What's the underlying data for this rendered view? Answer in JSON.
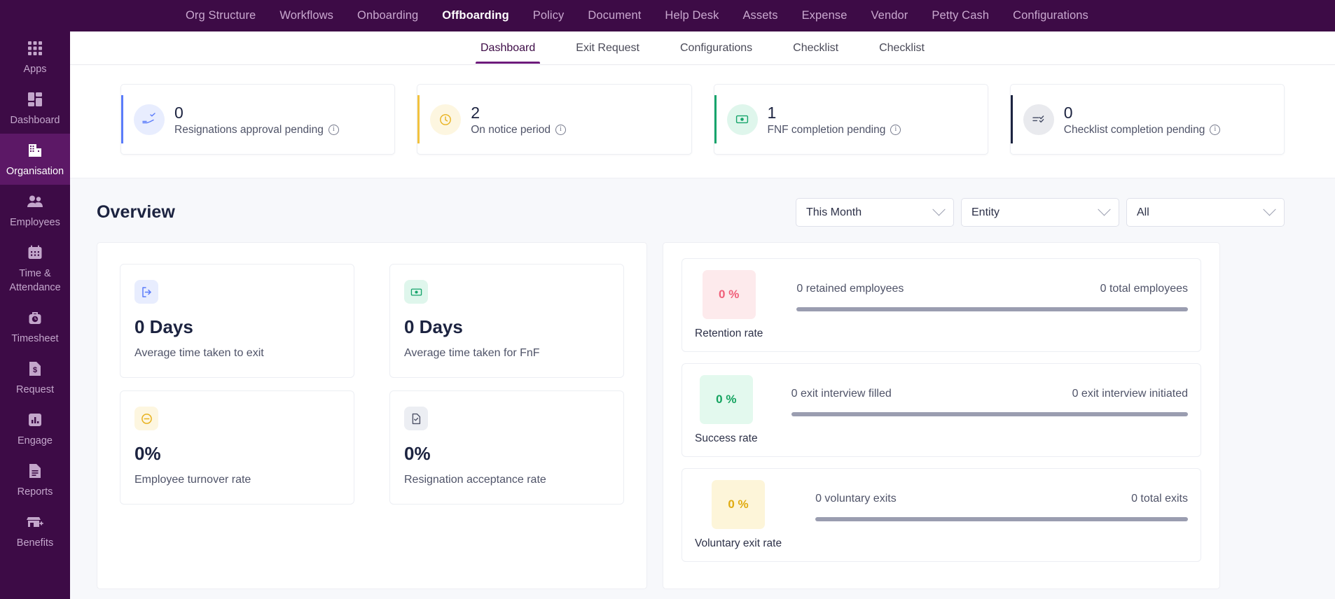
{
  "theme": {
    "brand_purple": "#3d0b46",
    "brand_purple_active": "#5c1866",
    "accent_underline": "#6d1b7b",
    "text_dark": "#1c2340"
  },
  "topnav": {
    "items": [
      {
        "label": "Org Structure",
        "active": false
      },
      {
        "label": "Workflows",
        "active": false
      },
      {
        "label": "Onboarding",
        "active": false
      },
      {
        "label": "Offboarding",
        "active": true
      },
      {
        "label": "Policy",
        "active": false
      },
      {
        "label": "Document",
        "active": false
      },
      {
        "label": "Help Desk",
        "active": false
      },
      {
        "label": "Assets",
        "active": false
      },
      {
        "label": "Expense",
        "active": false
      },
      {
        "label": "Vendor",
        "active": false
      },
      {
        "label": "Petty Cash",
        "active": false
      },
      {
        "label": "Configurations",
        "active": false
      }
    ]
  },
  "sidebar": {
    "items": [
      {
        "label": "Apps",
        "icon": "apps-grid-icon",
        "active": false
      },
      {
        "label": "Dashboard",
        "icon": "dashboard-icon",
        "active": false
      },
      {
        "label": "Organisation",
        "icon": "building-icon",
        "active": true
      },
      {
        "label": "Employees",
        "icon": "people-icon",
        "active": false
      },
      {
        "label": "Time & Attendance",
        "icon": "calendar-icon",
        "active": false
      },
      {
        "label": "Timesheet",
        "icon": "clock-bag-icon",
        "active": false
      },
      {
        "label": "Request",
        "icon": "money-document-icon",
        "active": false
      },
      {
        "label": "Engage",
        "icon": "bar-chart-icon",
        "active": false
      },
      {
        "label": "Reports",
        "icon": "report-document-icon",
        "active": false
      },
      {
        "label": "Benefits",
        "icon": "store-plus-icon",
        "active": false
      }
    ]
  },
  "subtabs": {
    "items": [
      {
        "label": "Dashboard",
        "active": true
      },
      {
        "label": "Exit Request",
        "active": false
      },
      {
        "label": "Configurations",
        "active": false
      },
      {
        "label": "Checklist",
        "active": false
      },
      {
        "label": "Checklist",
        "active": false
      }
    ]
  },
  "kpis": [
    {
      "value": "0",
      "label": "Resignations approval pending",
      "icon": "resignation-hand-icon",
      "accent": "#5b7cfa",
      "icon_bg": "#e8edfe",
      "icon_color": "#5b7cfa",
      "info": "i"
    },
    {
      "value": "2",
      "label": "On notice period",
      "icon": "clock-icon",
      "accent": "#f2c23e",
      "icon_bg": "#fdf6e0",
      "icon_color": "#e8b21f",
      "info": "i"
    },
    {
      "value": "1",
      "label": "FNF completion pending",
      "icon": "money-note-icon",
      "accent": "#16a46b",
      "icon_bg": "#dff6ec",
      "icon_color": "#16a46b",
      "info": "i"
    },
    {
      "value": "0",
      "label": "Checklist completion pending",
      "icon": "checklist-icon",
      "accent": "#1c2340",
      "icon_bg": "#e9eaee",
      "icon_color": "#434a63",
      "info": "i"
    }
  ],
  "overview": {
    "title": "Overview",
    "filters": [
      {
        "name": "period",
        "value": "This Month"
      },
      {
        "name": "entity",
        "value": "Entity"
      },
      {
        "name": "scope",
        "value": "All"
      }
    ],
    "metrics": [
      {
        "value": "0 Days",
        "label": "Average time taken to exit",
        "icon": "exit-door-icon",
        "icon_bg": "#e8edfe",
        "icon_color": "#5b7cfa"
      },
      {
        "value": "0 Days",
        "label": "Average time taken for FnF",
        "icon": "money-note-icon",
        "icon_bg": "#dff6ec",
        "icon_color": "#16a46b"
      },
      {
        "value": "0%",
        "label": "Employee turnover rate",
        "icon": "minus-circle-icon",
        "icon_bg": "#fdf6e0",
        "icon_color": "#e8b21f"
      },
      {
        "value": "0%",
        "label": "Resignation acceptance rate",
        "icon": "document-check-icon",
        "icon_bg": "#eceef3",
        "icon_color": "#4f5368"
      }
    ],
    "rates": [
      {
        "percent": "0 %",
        "name": "Retention rate",
        "badge_bg": "#fdeaec",
        "badge_color": "#f0607a",
        "left_stat": "0 retained employees",
        "right_stat": "0 total employees",
        "progress": 0
      },
      {
        "percent": "0 %",
        "name": "Success rate",
        "badge_bg": "#e3f9ee",
        "badge_color": "#14a35f",
        "left_stat": "0 exit interview filled",
        "right_stat": "0 exit interview initiated",
        "progress": 0
      },
      {
        "percent": "0 %",
        "name": "Voluntary exit rate",
        "badge_bg": "#fdf5d9",
        "badge_color": "#e0ab10",
        "left_stat": "0 voluntary exits",
        "right_stat": "0 total exits",
        "progress": 0
      }
    ]
  }
}
